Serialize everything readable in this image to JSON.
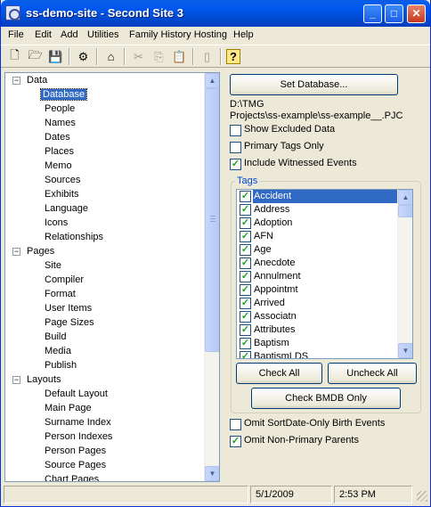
{
  "window": {
    "title": "ss-demo-site - Second Site 3"
  },
  "menubar": [
    "File",
    "Edit",
    "Add",
    "Utilities",
    "Family History Hosting",
    "Help"
  ],
  "toolbar": [
    {
      "name": "new-icon",
      "glyph": "🗋"
    },
    {
      "name": "open-icon",
      "glyph": "🗁"
    },
    {
      "name": "save-icon",
      "glyph": "💾"
    },
    {
      "name": "settings-icon",
      "glyph": "⚙"
    },
    {
      "name": "home-icon",
      "glyph": "⌂"
    },
    {
      "name": "cut-icon",
      "glyph": "✂"
    },
    {
      "name": "copy-icon",
      "glyph": "⎘"
    },
    {
      "name": "paste-icon",
      "glyph": "📋"
    },
    {
      "name": "blank-page-icon",
      "glyph": "▯"
    },
    {
      "name": "help-icon",
      "glyph": "?"
    }
  ],
  "tree": {
    "data": {
      "label": "Data",
      "items": [
        "Database",
        "People",
        "Names",
        "Dates",
        "Places",
        "Memo",
        "Sources",
        "Exhibits",
        "Language",
        "Icons",
        "Relationships"
      ],
      "selected": "Database"
    },
    "pages": {
      "label": "Pages",
      "items": [
        "Site",
        "Compiler",
        "Format",
        "User Items",
        "Page Sizes",
        "Build",
        "Media",
        "Publish"
      ]
    },
    "layouts": {
      "label": "Layouts",
      "items": [
        "Default Layout",
        "Main Page",
        "Surname Index",
        "Person Indexes",
        "Person Pages",
        "Source Pages",
        "Chart Pages"
      ]
    }
  },
  "panel": {
    "set_database_label": "Set Database...",
    "db_path_line1": "D:\\TMG",
    "db_path_line2": "Projects\\ss-example\\ss-example__.PJC",
    "show_excluded": {
      "label": "Show Excluded Data",
      "checked": false
    },
    "primary_tags_only": {
      "label": "Primary Tags Only",
      "checked": false
    },
    "include_witnessed": {
      "label": "Include Witnessed Events",
      "checked": true
    },
    "tags_legend": "Tags",
    "tags": [
      "Accident",
      "Address",
      "Adoption",
      "AFN",
      "Age",
      "Anecdote",
      "Annulment",
      "Appointmt",
      "Arrived",
      "Associatn",
      "Attributes",
      "Baptism",
      "BaptismLDS"
    ],
    "selected_tag": "Accident",
    "check_all_label": "Check All",
    "uncheck_all_label": "Uncheck All",
    "check_bmdb_label": "Check BMDB Only",
    "omit_sortdate": {
      "label": "Omit SortDate-Only Birth Events",
      "checked": false
    },
    "omit_nonprimary": {
      "label": "Omit Non-Primary Parents",
      "checked": true
    }
  },
  "status": {
    "date": "5/1/2009",
    "time": "2:53 PM"
  }
}
